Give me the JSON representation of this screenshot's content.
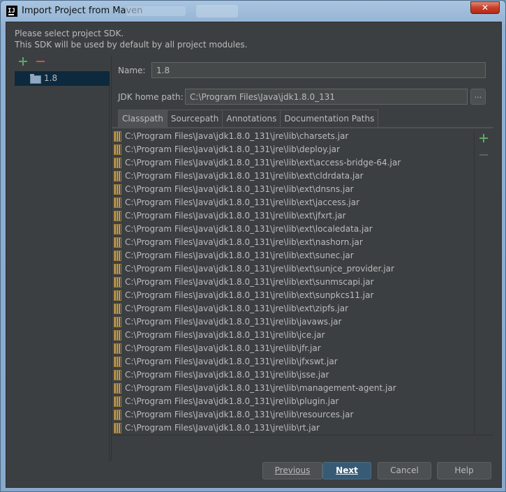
{
  "window": {
    "title": "Import Project from Maven",
    "close_label": "✕"
  },
  "description": {
    "line1": "Please select project SDK.",
    "line2": "This SDK will be used by default by all project modules."
  },
  "sdk_list": {
    "items": [
      {
        "label": "1.8",
        "icon": "folder-icon",
        "selected": true
      }
    ]
  },
  "form": {
    "name_label": "Name:",
    "name_value": "1.8",
    "jdk_label": "JDK home path:",
    "jdk_value": "C:\\Program Files\\Java\\jdk1.8.0_131",
    "browse_label": "..."
  },
  "tabs": [
    {
      "label": "Classpath",
      "active": true
    },
    {
      "label": "Sourcepath",
      "active": false
    },
    {
      "label": "Annotations",
      "active": false
    },
    {
      "label": "Documentation Paths",
      "active": false
    }
  ],
  "classpath": [
    "C:\\Program Files\\Java\\jdk1.8.0_131\\jre\\lib\\charsets.jar",
    "C:\\Program Files\\Java\\jdk1.8.0_131\\jre\\lib\\deploy.jar",
    "C:\\Program Files\\Java\\jdk1.8.0_131\\jre\\lib\\ext\\access-bridge-64.jar",
    "C:\\Program Files\\Java\\jdk1.8.0_131\\jre\\lib\\ext\\cldrdata.jar",
    "C:\\Program Files\\Java\\jdk1.8.0_131\\jre\\lib\\ext\\dnsns.jar",
    "C:\\Program Files\\Java\\jdk1.8.0_131\\jre\\lib\\ext\\jaccess.jar",
    "C:\\Program Files\\Java\\jdk1.8.0_131\\jre\\lib\\ext\\jfxrt.jar",
    "C:\\Program Files\\Java\\jdk1.8.0_131\\jre\\lib\\ext\\localedata.jar",
    "C:\\Program Files\\Java\\jdk1.8.0_131\\jre\\lib\\ext\\nashorn.jar",
    "C:\\Program Files\\Java\\jdk1.8.0_131\\jre\\lib\\ext\\sunec.jar",
    "C:\\Program Files\\Java\\jdk1.8.0_131\\jre\\lib\\ext\\sunjce_provider.jar",
    "C:\\Program Files\\Java\\jdk1.8.0_131\\jre\\lib\\ext\\sunmscapi.jar",
    "C:\\Program Files\\Java\\jdk1.8.0_131\\jre\\lib\\ext\\sunpkcs11.jar",
    "C:\\Program Files\\Java\\jdk1.8.0_131\\jre\\lib\\ext\\zipfs.jar",
    "C:\\Program Files\\Java\\jdk1.8.0_131\\jre\\lib\\javaws.jar",
    "C:\\Program Files\\Java\\jdk1.8.0_131\\jre\\lib\\jce.jar",
    "C:\\Program Files\\Java\\jdk1.8.0_131\\jre\\lib\\jfr.jar",
    "C:\\Program Files\\Java\\jdk1.8.0_131\\jre\\lib\\jfxswt.jar",
    "C:\\Program Files\\Java\\jdk1.8.0_131\\jre\\lib\\jsse.jar",
    "C:\\Program Files\\Java\\jdk1.8.0_131\\jre\\lib\\management-agent.jar",
    "C:\\Program Files\\Java\\jdk1.8.0_131\\jre\\lib\\plugin.jar",
    "C:\\Program Files\\Java\\jdk1.8.0_131\\jre\\lib\\resources.jar",
    "C:\\Program Files\\Java\\jdk1.8.0_131\\jre\\lib\\rt.jar"
  ],
  "buttons": {
    "previous": "Previous",
    "next": "Next",
    "cancel": "Cancel",
    "help": "Help"
  },
  "colors": {
    "background": "#3c3f41",
    "selection": "#0d293e",
    "add_green": "#59a869",
    "remove_red": "#c75450",
    "primary_button": "#385b75"
  }
}
